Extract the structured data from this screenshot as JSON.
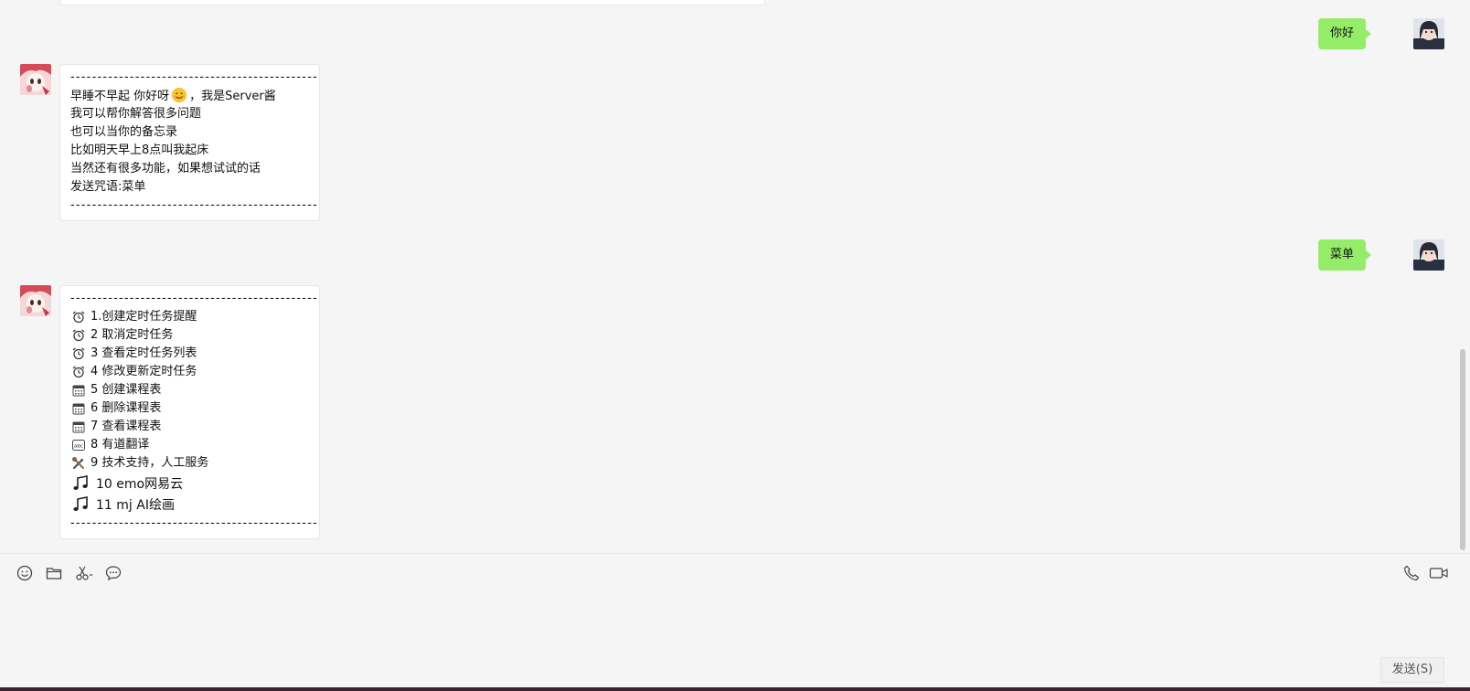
{
  "colors": {
    "sent_bubble": "#95ec69",
    "received_bubble": "#ffffff",
    "background": "#f5f5f5"
  },
  "messages": {
    "m1": {
      "sender": "me",
      "text": "你好"
    },
    "m2": {
      "sender": "bot",
      "lines": [
        "----------------------------------------------",
        "早睡不早起 你好呀",
        "，我是Server酱",
        "我可以帮你解答很多问题",
        "也可以当你的备忘录",
        "比如明天早上8点叫我起床",
        "当然还有很多功能，如果想试试的话",
        "发送咒语:菜单",
        "----------------------------------------------"
      ],
      "emoji": "smile-emoji"
    },
    "m3": {
      "sender": "me",
      "text": "菜单"
    },
    "m4": {
      "sender": "bot",
      "dash_top": "----------------------------------------------",
      "items": [
        {
          "icon": "alarm-clock-icon",
          "text": "1.创建定时任务提醒"
        },
        {
          "icon": "alarm-clock-icon",
          "text": "2 取消定时任务"
        },
        {
          "icon": "alarm-clock-icon",
          "text": "3 查看定时任务列表"
        },
        {
          "icon": "alarm-clock-icon",
          "text": "4 修改更新定时任务"
        },
        {
          "icon": "calendar-icon",
          "text": "5 创建课程表"
        },
        {
          "icon": "calendar-icon",
          "text": "6 删除课程表"
        },
        {
          "icon": "calendar-icon",
          "text": "7 查看课程表"
        },
        {
          "icon": "abc-icon",
          "text": "8 有道翻译"
        },
        {
          "icon": "tools-icon",
          "text": "9 技术支持，人工服务"
        },
        {
          "icon": "music-note-icon",
          "text": "10 emo网易云"
        },
        {
          "icon": "music-note-icon",
          "text": "11 mj AI绘画"
        }
      ],
      "dash_bottom": "----------------------------------------------"
    }
  },
  "toolbar": {
    "left_icons": [
      "emoji-icon",
      "folder-icon",
      "screenshot-scissors-icon",
      "chat-history-icon"
    ],
    "right_icons": [
      "voice-call-icon",
      "video-call-icon"
    ]
  },
  "send_button": {
    "label": "发送(S)"
  }
}
